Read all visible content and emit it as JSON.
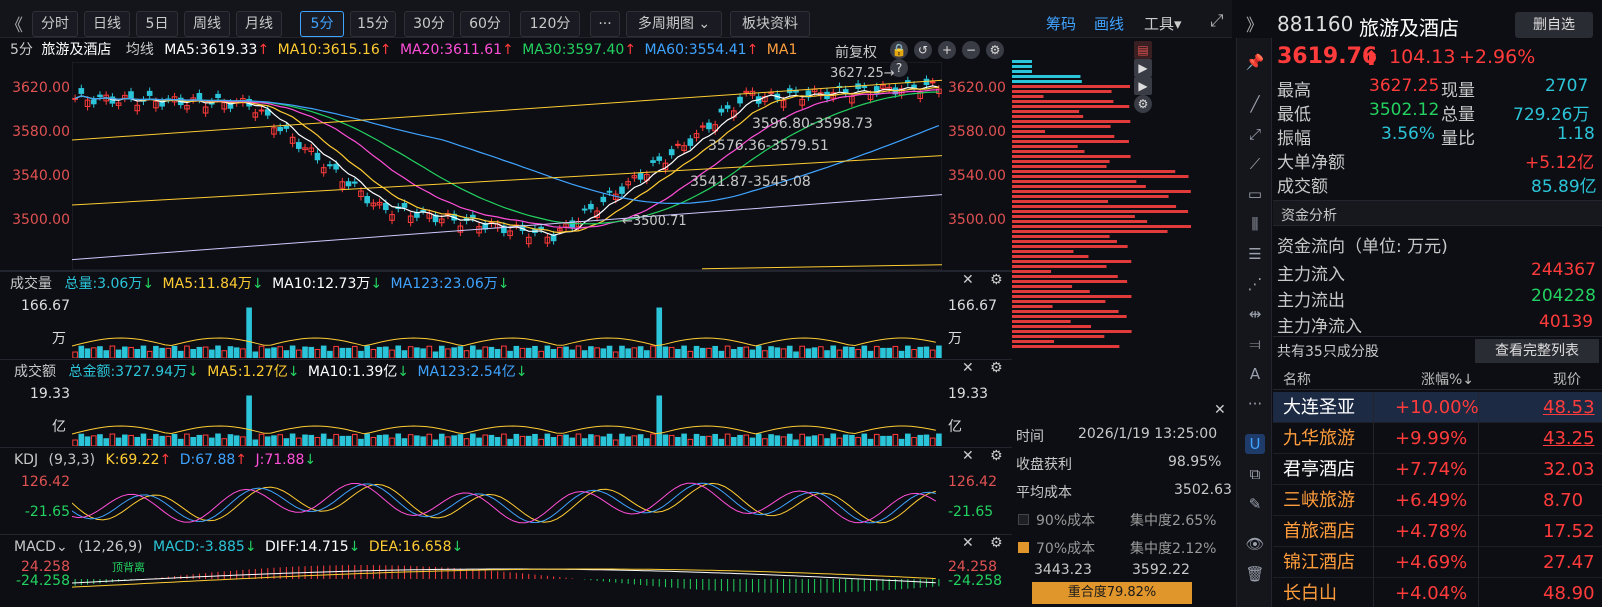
{
  "toolbar": {
    "back_icon": "double-chevron-left-icon",
    "periods": [
      "分时",
      "日线",
      "5日",
      "周线",
      "月线",
      "5分",
      "15分",
      "30分",
      "60分",
      "120分"
    ],
    "active_period": "5分",
    "more": "···",
    "multi_period": "多周期图",
    "sector_info": "板块资料",
    "chips": "筹码",
    "draw": "画线",
    "tools": "工具",
    "expand_icon": "expand-icon",
    "collapse_icon": "double-chevron-right-icon"
  },
  "main_chart": {
    "period": "5分",
    "name": "旅游及酒店",
    "line_type": "均线",
    "ma5": "MA5:3619.33",
    "ma10": "MA10:3615.16",
    "ma20": "MA20:3611.61",
    "ma30": "MA30:3597.40",
    "ma60": "MA60:3554.41",
    "ma120": "MA1",
    "adjust": "前复权",
    "y_ticks": [
      "3620.00",
      "3580.00",
      "3540.00",
      "3500.00"
    ],
    "annotations": [
      "3627.25→",
      "3596.80-3598.73",
      "3576.36-3579.51",
      "3541.87-3545.08",
      "←3500.71"
    ]
  },
  "chart_data": {
    "type": "candlestick",
    "ylim": [
      3480,
      3640
    ],
    "high": 3627.25,
    "low": 3500.71,
    "levels": [
      "3596.80-3598.73",
      "3576.36-3579.51",
      "3541.87-3545.08"
    ]
  },
  "volume": {
    "title": "成交量",
    "total": "总量:3.06万",
    "ma5": "MA5:11.84万",
    "ma10": "MA10:12.73万",
    "ma123": "MA123:23.06万",
    "top": "166.67",
    "unit": "万"
  },
  "amount": {
    "title": "成交额",
    "total": "总金额:3727.94万",
    "ma5": "MA5:1.27亿",
    "ma10": "MA10:1.39亿",
    "ma123": "MA123:2.54亿",
    "top": "19.33",
    "unit": "亿"
  },
  "kdj": {
    "title": "KDJ",
    "params": "(9,3,3)",
    "k": "K:69.22",
    "d": "D:67.88",
    "j": "J:71.88",
    "top": "126.42",
    "bottom": "-21.65"
  },
  "macd": {
    "title": "MACD",
    "params": "(12,26,9)",
    "macd": "MACD:-3.885",
    "diff": "DIFF:14.715",
    "dea": "DEA:16.658",
    "top": "24.258",
    "bottom": "-24.258",
    "note": "顶背离"
  },
  "chips": {
    "time_label": "时间",
    "time": "2026/1/19 13:25:00",
    "profit_label": "收盘获利",
    "profit": "98.95%",
    "avg_label": "平均成本",
    "avg": "3502.63",
    "c90_label": "90%成本",
    "c90_conc": "集中度2.65%",
    "c70_label": "70%成本",
    "c70_conc": "集中度2.12%",
    "range_low": "3443.23",
    "range_high": "3592.22",
    "overlap": "重合度79.82%"
  },
  "quote": {
    "code": "881160",
    "name": "旅游及酒店",
    "remove": "删自选",
    "price": "3619.76",
    "change": "104.13",
    "change_pct": "+2.96%",
    "high_label": "最高",
    "high": "3627.25",
    "now_label": "现量",
    "now": "2707",
    "low_label": "最低",
    "low": "3502.12",
    "vol_label": "总量",
    "vol": "729.26万",
    "amp_label": "振幅",
    "amp": "3.56%",
    "ratio_label": "量比",
    "ratio": "1.18",
    "big_label": "大单净额",
    "big": "+5.12亿",
    "turnover_label": "成交额",
    "turnover": "85.89亿"
  },
  "fund": {
    "title": "资金分析",
    "flow_title": "资金流向（单位: 万元)",
    "in_label": "主力流入",
    "in": "244367",
    "out_label": "主力流出",
    "out": "204228",
    "net_label": "主力净流入",
    "net": "40139"
  },
  "constituents": {
    "summary": "共有35只成分股",
    "view_all": "查看完整列表",
    "headers": [
      "名称",
      "涨幅%↓",
      "现价"
    ],
    "rows": [
      {
        "name": "大连圣亚",
        "pct": "+10.00%",
        "price": "48.53"
      },
      {
        "name": "九华旅游",
        "pct": "+9.99%",
        "price": "43.25"
      },
      {
        "name": "君亭酒店",
        "pct": "+7.74%",
        "price": "32.03"
      },
      {
        "name": "三峡旅游",
        "pct": "+6.49%",
        "price": "8.70"
      },
      {
        "name": "首旅酒店",
        "pct": "+4.78%",
        "price": "17.52"
      },
      {
        "name": "锦江酒店",
        "pct": "+4.69%",
        "price": "27.47"
      },
      {
        "name": "长白山",
        "pct": "+4.04%",
        "price": "48.90"
      }
    ]
  }
}
